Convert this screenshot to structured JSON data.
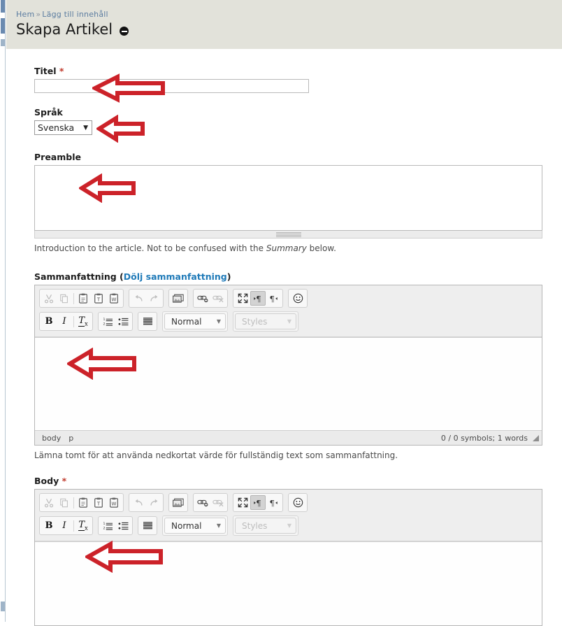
{
  "header": {
    "breadcrumb": {
      "home": "Hem",
      "separator": "»",
      "current": "Lägg till innehåll"
    },
    "title": "Skapa Artikel",
    "collapse_icon": "minus-circle-icon"
  },
  "form": {
    "title_field": {
      "label": "Titel",
      "required_marker": "*",
      "value": "",
      "placeholder": ""
    },
    "language_field": {
      "label": "Språk",
      "value": "Svenska",
      "options": [
        "Svenska"
      ]
    },
    "preamble_field": {
      "label": "Preamble",
      "value": "",
      "description_before": "Introduction to the article. Not to be confused with the ",
      "description_em": "Summary",
      "description_after": " below."
    },
    "summary_field": {
      "label": "Sammanfattning (",
      "toggle_link": "Dölj sammanfattning",
      "label_close": ")",
      "value": "",
      "description": "Lämna tomt för att använda nedkortat värde för fullständig text som sammanfattning.",
      "status": {
        "path": [
          "body",
          "p"
        ],
        "counter": "0 / 0 symbols; 1 words"
      }
    },
    "body_field": {
      "label": "Body",
      "required_marker": "*",
      "value": ""
    }
  },
  "editor_toolbar": {
    "row1": [
      {
        "name": "cut-icon",
        "title": "Cut",
        "state": "disabled"
      },
      {
        "name": "copy-icon",
        "title": "Copy",
        "state": "disabled"
      },
      {
        "name": "paste-icon",
        "title": "Paste",
        "state": "enabled"
      },
      {
        "name": "paste-as-plain-text-icon",
        "title": "Paste as plain text",
        "state": "enabled"
      },
      {
        "name": "paste-from-word-icon",
        "title": "Paste from Word",
        "state": "enabled"
      },
      {
        "name": "undo-icon",
        "title": "Undo",
        "state": "disabled"
      },
      {
        "name": "redo-icon",
        "title": "Redo",
        "state": "disabled"
      },
      {
        "name": "image-icon",
        "title": "Image",
        "state": "enabled"
      },
      {
        "name": "link-icon",
        "title": "Link",
        "state": "enabled"
      },
      {
        "name": "unlink-icon",
        "title": "Unlink",
        "state": "disabled"
      },
      {
        "name": "maximize-icon",
        "title": "Maximize",
        "state": "enabled"
      },
      {
        "name": "text-direction-ltr-icon",
        "title": "Left to right",
        "state": "active"
      },
      {
        "name": "text-direction-rtl-icon",
        "title": "Right to left",
        "state": "enabled"
      },
      {
        "name": "smiley-icon",
        "title": "Smiley",
        "state": "enabled"
      }
    ],
    "row2": [
      {
        "name": "bold-icon",
        "title": "Bold",
        "state": "enabled"
      },
      {
        "name": "italic-icon",
        "title": "Italic",
        "state": "enabled"
      },
      {
        "name": "remove-format-icon",
        "title": "Remove Format",
        "state": "enabled"
      },
      {
        "name": "numbered-list-icon",
        "title": "Insert/Remove Numbered List",
        "state": "enabled"
      },
      {
        "name": "bulleted-list-icon",
        "title": "Insert/Remove Bulleted List",
        "state": "enabled"
      },
      {
        "name": "justify-icon",
        "title": "Justify",
        "state": "enabled"
      }
    ],
    "format_combo": {
      "label": "Normal",
      "state": "enabled"
    },
    "styles_combo": {
      "label": "Styles",
      "state": "disabled"
    }
  },
  "annotations": {
    "arrow_color": "#cc2229",
    "arrows": [
      {
        "name": "arrow-pointing-title-input"
      },
      {
        "name": "arrow-pointing-language-select"
      },
      {
        "name": "arrow-pointing-preamble-textarea"
      },
      {
        "name": "arrow-pointing-summary-editor"
      },
      {
        "name": "arrow-pointing-body-editor"
      }
    ]
  },
  "colors": {
    "header_bg": "#e2e2da",
    "breadcrumb_link": "#5b7ca0",
    "toggle_link": "#1f7ab8",
    "required_star": "#c0392b",
    "page_bg": "#ffffff"
  }
}
